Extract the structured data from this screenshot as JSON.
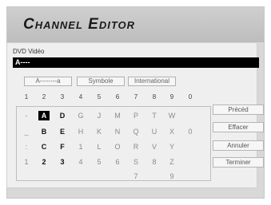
{
  "header": {
    "title": "Channel Editor"
  },
  "field": {
    "label": "DVD Vidéo",
    "value": "A----"
  },
  "modes": [
    "A--------a",
    "Symbole",
    "International"
  ],
  "numbers": [
    "1",
    "2",
    "3",
    "4",
    "5",
    "6",
    "7",
    "8",
    "9",
    "0"
  ],
  "grid": [
    [
      "-",
      "A",
      "D",
      "G",
      "J",
      "M",
      "P",
      "T",
      "W"
    ],
    [
      "_",
      "B",
      "E",
      "H",
      "K",
      "N",
      "Q",
      "U",
      "X",
      "0"
    ],
    [
      ":",
      "C",
      "F",
      "1",
      "L",
      "O",
      "R",
      "V",
      "Y"
    ],
    [
      "1",
      "2",
      "3",
      "4",
      "5",
      "6",
      "S",
      "8",
      "Z"
    ],
    [
      "",
      "",
      "",
      "",
      "",
      "",
      "7",
      "",
      "9"
    ]
  ],
  "buttons": [
    "Précéd",
    "Effacer",
    "Annuler",
    "Terminer"
  ]
}
